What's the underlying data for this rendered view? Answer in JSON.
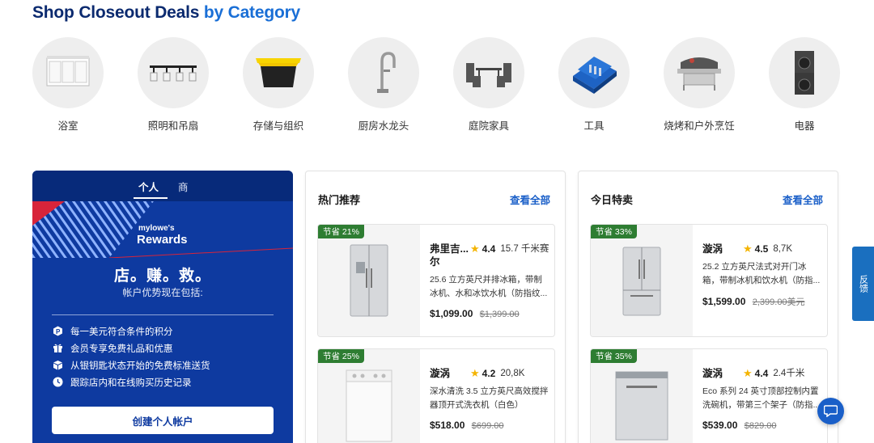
{
  "header": {
    "title_main": "Shop Closeout Deals",
    "title_accent": "by Category"
  },
  "categories": [
    {
      "label": "浴室",
      "icon": "bathroom-vanity-icon"
    },
    {
      "label": "照明和吊扇",
      "icon": "light-fixture-icon"
    },
    {
      "label": "存储与组织",
      "icon": "storage-tote-icon"
    },
    {
      "label": "厨房水龙头",
      "icon": "kitchen-faucet-icon"
    },
    {
      "label": "庭院家具",
      "icon": "patio-set-icon"
    },
    {
      "label": "工具",
      "icon": "tool-set-icon"
    },
    {
      "label": "烧烤和户外烹饪",
      "icon": "grill-icon"
    },
    {
      "label": "电器",
      "icon": "washer-dryer-icon"
    }
  ],
  "rewards": {
    "tab_personal": "个人",
    "tab_business": "商",
    "logo_line1": "mylowe's",
    "logo_line2": "Rewards",
    "title": "店。赚。救。",
    "subtitle": "帐户优势现在包括:",
    "benefits": [
      {
        "text": "每一美元符合条件的积分",
        "icon": "points-icon"
      },
      {
        "text": "会员专享免费礼品和优惠",
        "icon": "gift-icon"
      },
      {
        "text": "从银钥匙状态开始的免费标准送货",
        "icon": "delivery-box-icon"
      },
      {
        "text": "跟踪店内和在线购买历史记录",
        "icon": "clock-icon"
      }
    ],
    "cta": "创建个人帐户",
    "colors": {
      "panel": "#0e3aa0",
      "tabs": "#072a7a",
      "stripe_red": "#d8243a"
    }
  },
  "panels": [
    {
      "title": "热门推荐",
      "view_all": "查看全部",
      "products": [
        {
          "save": "节省 21%",
          "brand": "弗里吉...尔",
          "rating": "4.4",
          "count": "15.7 千米赛",
          "desc": "25.6 立方英尺并排冰箱，带制冰机、水和冰饮水机（防指纹...",
          "price": "$1,099.00",
          "was": "$1,399.00",
          "image": "side-by-side-fridge"
        },
        {
          "save": "节省 25%",
          "brand": "漩涡",
          "rating": "4.2",
          "count": "20,8K",
          "desc": "深水清洗 3.5 立方英尺高效搅拌器顶开式洗衣机（白色）",
          "price": "$518.00",
          "was": "$699.00",
          "image": "top-load-washer"
        }
      ]
    },
    {
      "title": "今日特卖",
      "view_all": "查看全部",
      "products": [
        {
          "save": "节省 33%",
          "brand": "漩涡",
          "rating": "4.5",
          "count": "8,7K",
          "desc": "25.2 立方英尺法式对开门冰箱，带制冰机和饮水机（防指...",
          "price": "$1,599.00",
          "was": "2,399.00美元",
          "image": "french-door-fridge"
        },
        {
          "save": "节省 35%",
          "brand": "漩涡",
          "rating": "4.4",
          "count": "2.4千米",
          "desc": "Eco 系列 24 英寸顶部控制内置洗碗机，带第三个架子（防指...",
          "price": "$539.00",
          "was": "$829.00",
          "image": "dishwasher"
        }
      ]
    }
  ],
  "feedback_label": "反馈",
  "colors": {
    "title": "#0b2a6f",
    "accent": "#1a6fd6",
    "link": "#1a5fc8",
    "save_badge": "#2e7d32",
    "star": "#f4b400"
  }
}
